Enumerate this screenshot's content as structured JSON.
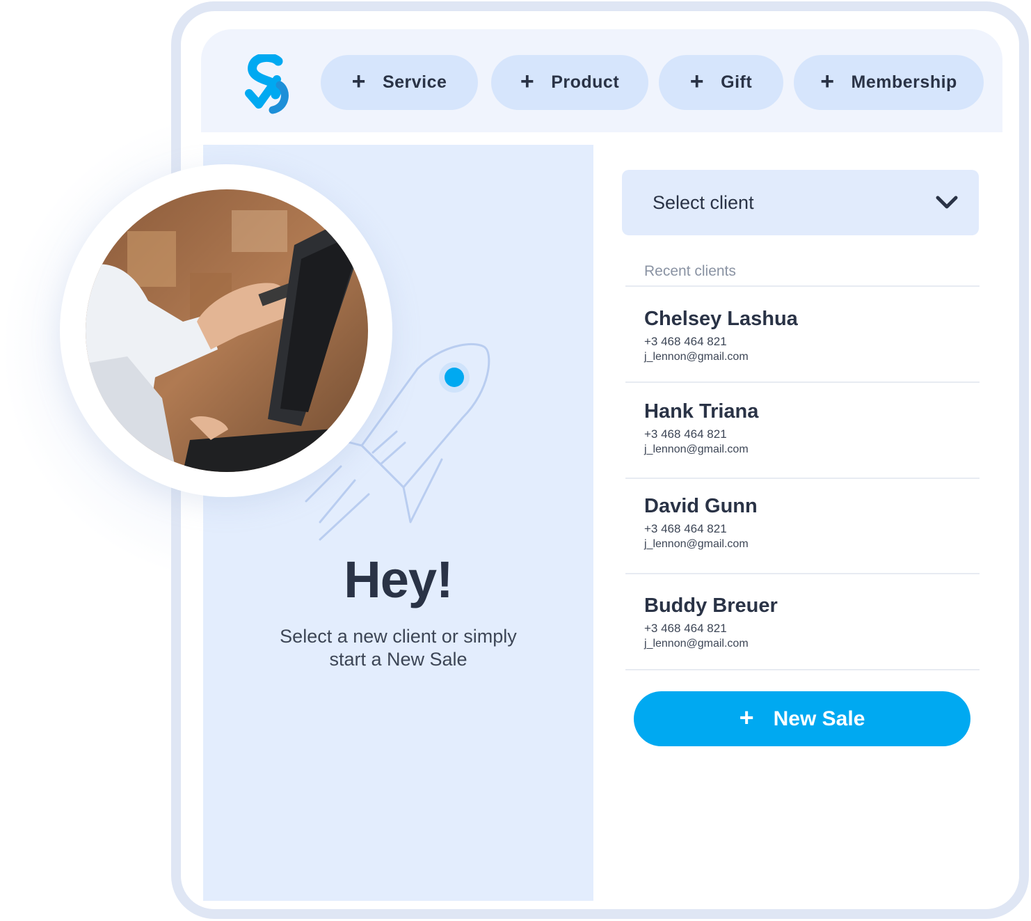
{
  "colors": {
    "accent": "#00a9f1",
    "chip_bg": "#d6e5fc",
    "panel_bg": "#e3edfd",
    "text_dark": "#2a3346"
  },
  "toolbar": {
    "logo_icon": "brand-s-checkmark-logo",
    "plus_icon": "+",
    "chips": [
      {
        "label": "Service"
      },
      {
        "label": "Product"
      },
      {
        "label": "Gift"
      },
      {
        "label": "Membership"
      }
    ]
  },
  "welcome": {
    "title": "Hey!",
    "line1": "Select a new client or simply",
    "line2": "start a New Sale",
    "illustration_icon": "rocket-icon",
    "photo": "cashier-using-pos-terminal-photo"
  },
  "client_select": {
    "placeholder": "Select client",
    "icon": "chevron-down-icon"
  },
  "recent": {
    "label": "Recent clients",
    "clients": [
      {
        "name": "Chelsey Lashua",
        "phone": "+3 468 464 821",
        "email": "j_lennon@gmail.com"
      },
      {
        "name": "Hank Triana",
        "phone": "+3 468 464 821",
        "email": "j_lennon@gmail.com"
      },
      {
        "name": "David Gunn",
        "phone": "+3 468 464 821",
        "email": "j_lennon@gmail.com"
      },
      {
        "name": "Buddy Breuer",
        "phone": "+3 468 464 821",
        "email": "j_lennon@gmail.com"
      }
    ]
  },
  "new_sale": {
    "label": "New Sale",
    "plus": "+"
  }
}
